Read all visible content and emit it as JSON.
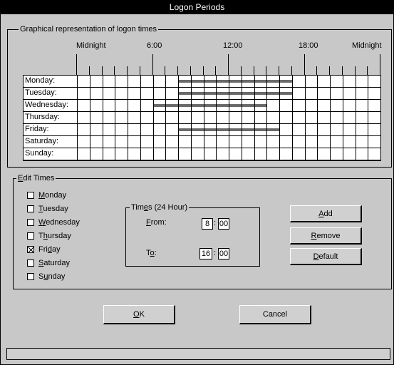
{
  "window": {
    "title": "Logon Periods"
  },
  "graph": {
    "legend": "Graphical representation of logon times",
    "time_labels": [
      "Midnight",
      "6:00",
      "12:00",
      "18:00",
      "Midnight"
    ],
    "days": [
      {
        "label": "Monday:",
        "start": 8,
        "end": 17
      },
      {
        "label": "Tuesday:",
        "start": 8,
        "end": 17
      },
      {
        "label": "Wednesday:",
        "start": 6,
        "end": 15
      },
      {
        "label": "Thursday:",
        "start": null,
        "end": null
      },
      {
        "label": "Friday:",
        "start": 8,
        "end": 16
      },
      {
        "label": "Saturday:",
        "start": null,
        "end": null
      },
      {
        "label": "Sunday:",
        "start": null,
        "end": null
      }
    ]
  },
  "edit_times": {
    "legend_u": "E",
    "legend_rest": "dit Times",
    "checkboxes": [
      {
        "u": "M",
        "rest": "onday",
        "checked": false
      },
      {
        "u": "T",
        "rest": "uesday",
        "checked": false
      },
      {
        "u": "W",
        "rest": "ednesday",
        "checked": false
      },
      {
        "pre": "T",
        "u": "h",
        "rest": "ursday",
        "checked": false
      },
      {
        "pre": "Fri",
        "u": "d",
        "rest": "ay",
        "checked": true
      },
      {
        "u": "S",
        "rest": "aturday",
        "checked": false
      },
      {
        "pre": "S",
        "u": "u",
        "rest": "nday",
        "checked": false
      }
    ],
    "times": {
      "legend_pre": "Tim",
      "legend_u": "e",
      "legend_rest": "s (24 Hour)",
      "from_u": "F",
      "from_rest": "rom:",
      "to_pre": "T",
      "to_u": "o",
      "to_rest": ":",
      "from_hour": "8",
      "from_min": "00",
      "to_hour": "16",
      "to_min": "00",
      "separator": ":"
    },
    "buttons": {
      "add_u": "A",
      "add_rest": "dd",
      "remove_u": "R",
      "remove_rest": "emove",
      "default_u": "D",
      "default_rest": "efault"
    }
  },
  "dialog_buttons": {
    "ok_u": "O",
    "ok_rest": "K",
    "cancel": "Cancel"
  },
  "status": {
    "text": ""
  }
}
